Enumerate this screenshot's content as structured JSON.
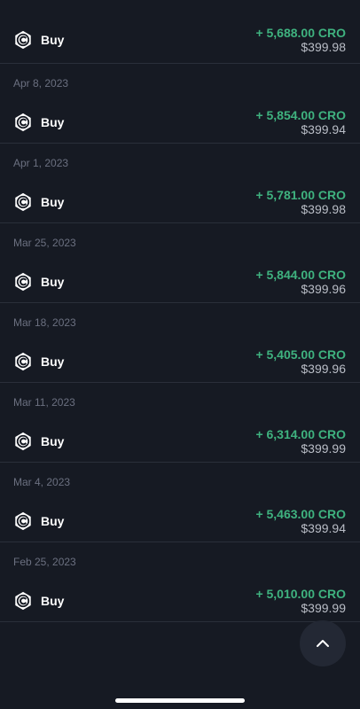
{
  "first": {
    "type": "Buy",
    "amount": "+ 5,688.00 CRO",
    "fiat": "$399.98"
  },
  "groups": [
    {
      "date": "Apr 8, 2023",
      "type": "Buy",
      "amount": "+ 5,854.00 CRO",
      "fiat": "$399.94"
    },
    {
      "date": "Apr 1, 2023",
      "type": "Buy",
      "amount": "+ 5,781.00 CRO",
      "fiat": "$399.98"
    },
    {
      "date": "Mar 25, 2023",
      "type": "Buy",
      "amount": "+ 5,844.00 CRO",
      "fiat": "$399.96"
    },
    {
      "date": "Mar 18, 2023",
      "type": "Buy",
      "amount": "+ 5,405.00 CRO",
      "fiat": "$399.96"
    },
    {
      "date": "Mar 11, 2023",
      "type": "Buy",
      "amount": "+ 6,314.00 CRO",
      "fiat": "$399.99"
    },
    {
      "date": "Mar 4, 2023",
      "type": "Buy",
      "amount": "+ 5,463.00 CRO",
      "fiat": "$399.94"
    },
    {
      "date": "Feb 25, 2023",
      "type": "Buy",
      "amount": "+ 5,010.00 CRO",
      "fiat": "$399.99"
    }
  ],
  "icons": {
    "coin": "cronos-coin-icon",
    "scroll_top": "chevron-up-icon"
  },
  "colors": {
    "background": "#161a23",
    "positive": "#3fb27f",
    "muted": "#6b7080",
    "divider": "#2a2f3a"
  }
}
